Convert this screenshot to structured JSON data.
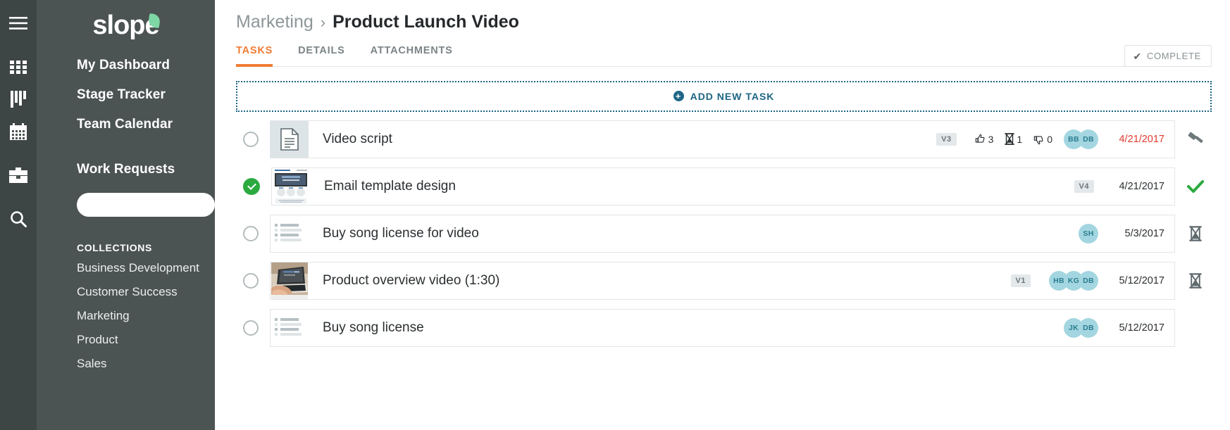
{
  "rail": {
    "icons": [
      {
        "name": "hamburger-menu-icon",
        "glyph": "menu"
      },
      {
        "name": "dashboard-grid-icon",
        "glyph": "grid"
      },
      {
        "name": "stage-tracker-icon",
        "glyph": "bars"
      },
      {
        "name": "calendar-icon",
        "glyph": "calendar"
      },
      {
        "name": "briefcase-icon",
        "glyph": "briefcase"
      },
      {
        "name": "search-icon",
        "glyph": "search"
      }
    ]
  },
  "sidebar": {
    "logo": "slope",
    "nav": [
      {
        "label": "My Dashboard"
      },
      {
        "label": "Stage Tracker"
      },
      {
        "label": "Team Calendar"
      },
      {
        "label": "Work Requests"
      }
    ],
    "search": {
      "value": "",
      "placeholder": ""
    },
    "collections_title": "COLLECTIONS",
    "collections": [
      {
        "label": "Business Development"
      },
      {
        "label": "Customer Success"
      },
      {
        "label": "Marketing"
      },
      {
        "label": "Product"
      },
      {
        "label": "Sales"
      }
    ]
  },
  "header": {
    "breadcrumb_parent": "Marketing",
    "breadcrumb_sep": "›",
    "breadcrumb_current": "Product Launch Video",
    "tabs": [
      {
        "label": "TASKS",
        "active": true
      },
      {
        "label": "DETAILS",
        "active": false
      },
      {
        "label": "ATTACHMENTS",
        "active": false
      }
    ],
    "complete_button": "COMPLETE",
    "complete_check": "✔"
  },
  "main": {
    "add_task_label": "ADD NEW TASK",
    "add_task_plus": "+",
    "tasks": [
      {
        "title": "Video script",
        "status": "open",
        "thumb": "document",
        "version": "V3",
        "reactions": [
          {
            "icon": "thumbs-up-icon",
            "count": "3"
          },
          {
            "icon": "hourglass-icon",
            "count": "1"
          },
          {
            "icon": "thumbs-down-icon",
            "count": "0"
          }
        ],
        "avatars": [
          "BB",
          "DB"
        ],
        "date": "4/21/2017",
        "overdue": true,
        "row_icon": "gavel-icon"
      },
      {
        "title": "Email template design",
        "status": "done",
        "thumb": "email-template",
        "version": "V4",
        "reactions": [],
        "avatars": [],
        "date": "4/21/2017",
        "overdue": false,
        "row_icon": "check-icon"
      },
      {
        "title": "Buy song license for video",
        "status": "open",
        "thumb": "list",
        "version": "",
        "reactions": [],
        "avatars": [
          "SH"
        ],
        "date": "5/3/2017",
        "overdue": false,
        "row_icon": "hourglass-icon"
      },
      {
        "title": "Product overview video (1:30)",
        "status": "open",
        "thumb": "video",
        "version": "V1",
        "reactions": [],
        "avatars": [
          "HB",
          "KG",
          "DB"
        ],
        "date": "5/12/2017",
        "overdue": false,
        "row_icon": "hourglass-icon"
      },
      {
        "title": "Buy song license",
        "status": "open",
        "thumb": "list",
        "version": "",
        "reactions": [],
        "avatars": [
          "JK",
          "DB"
        ],
        "date": "5/12/2017",
        "overdue": false,
        "row_icon": "none"
      }
    ]
  },
  "colors": {
    "rail_bg": "#3e4545",
    "sidebar_bg": "#4c5353",
    "accent_orange": "#f07c34",
    "accent_teal": "#1d6585",
    "avatar_bg": "#a3d6e0",
    "overdue_red": "#e13b2e",
    "done_green": "#2caa3f",
    "logo_leaf_green": "#7ed6a5"
  }
}
